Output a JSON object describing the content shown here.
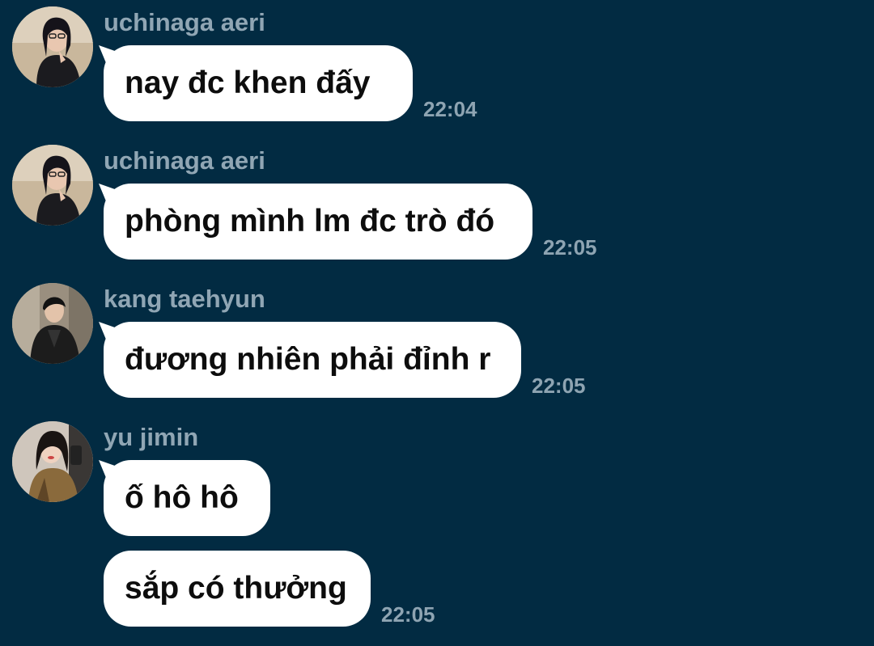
{
  "messages": [
    {
      "sender": "uchinaga aeri",
      "avatar": "avatar-aeri",
      "bubbles": [
        "nay đc khen đấy"
      ],
      "time": "22:04"
    },
    {
      "sender": "uchinaga aeri",
      "avatar": "avatar-aeri",
      "bubbles": [
        "phòng mình lm đc trò đó"
      ],
      "time": "22:05"
    },
    {
      "sender": "kang taehyun",
      "avatar": "avatar-taehyun",
      "bubbles": [
        "đương nhiên phải đỉnh r"
      ],
      "time": "22:05"
    },
    {
      "sender": "yu jimin",
      "avatar": "avatar-jimin",
      "bubbles": [
        "ố hô hô",
        "sắp có thưởng"
      ],
      "time": "22:05"
    }
  ],
  "colors": {
    "background": "#022b42",
    "bubble": "#ffffff",
    "sender_name": "#90a6b4",
    "timestamp": "#8ea4b2"
  }
}
